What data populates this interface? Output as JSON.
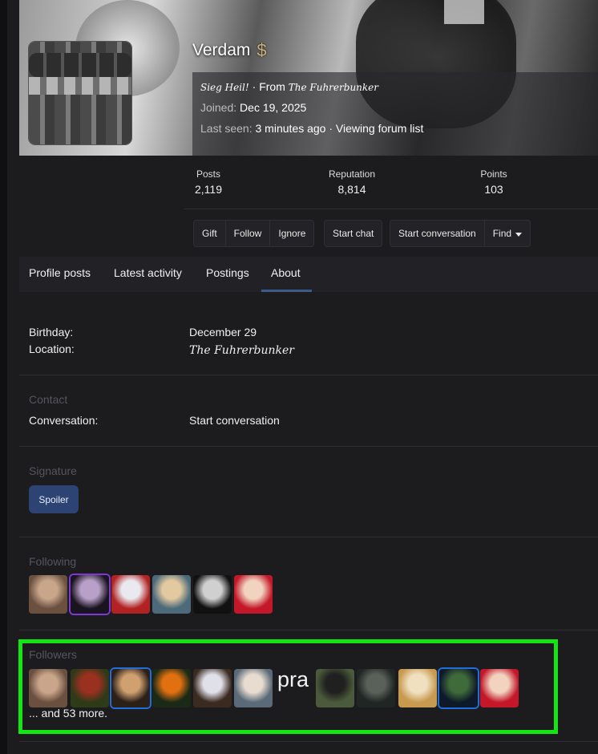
{
  "profile": {
    "username": "Verdam",
    "dollar_icon": "$",
    "tagline_title": "Sieg Heil!",
    "tagline_from": "From",
    "tagline_location": "The Fuhrerbunker",
    "separator": "·",
    "joined_label": "Joined:",
    "joined_value": "Dec 19, 2025",
    "last_seen_label": "Last seen:",
    "last_seen_value": "3 minutes ago",
    "last_seen_activity": "Viewing forum list"
  },
  "stats": [
    {
      "label": "Posts",
      "value": "2,119"
    },
    {
      "label": "Reputation",
      "value": "8,814"
    },
    {
      "label": "Points",
      "value": "103"
    }
  ],
  "actions": {
    "gift": "Gift",
    "follow": "Follow",
    "ignore": "Ignore",
    "start_chat": "Start chat",
    "start_conversation": "Start conversation",
    "find": "Find"
  },
  "tabs": [
    "Profile posts",
    "Latest activity",
    "Postings",
    "About"
  ],
  "about": {
    "birthday_label": "Birthday:",
    "birthday_value": "December 29",
    "location_label": "Location:",
    "location_value": "The Fuhrerbunker"
  },
  "contact": {
    "heading": "Contact",
    "conversation_label": "Conversation:",
    "conversation_value": "Start conversation"
  },
  "signature": {
    "heading": "Signature",
    "spoiler_label": "Spoiler"
  },
  "following": {
    "heading": "Following",
    "avatars": [
      {
        "name": "following-avatar-1",
        "colors": [
          "#6b5040",
          "#c9a68a"
        ]
      },
      {
        "name": "following-avatar-2",
        "colors": [
          "#1a1420",
          "#b9a0c8"
        ],
        "ring": "purple"
      },
      {
        "name": "following-avatar-3",
        "colors": [
          "#b32222",
          "#e9e9ef"
        ]
      },
      {
        "name": "following-avatar-4",
        "colors": [
          "#4c6a7a",
          "#e2c9a0"
        ]
      },
      {
        "name": "following-avatar-5",
        "colors": [
          "#111111",
          "#d0d0d0"
        ]
      },
      {
        "name": "following-avatar-6",
        "colors": [
          "#c4182a",
          "#f1d3c0"
        ]
      }
    ]
  },
  "followers": {
    "heading": "Followers",
    "inline_text": "pra",
    "more_text": "... and 53 more.",
    "avatars": [
      {
        "name": "follower-avatar-1",
        "colors": [
          "#6b5040",
          "#c9a68a"
        ]
      },
      {
        "name": "follower-avatar-2",
        "colors": [
          "#2f3a18",
          "#9a3020"
        ]
      },
      {
        "name": "follower-avatar-3",
        "colors": [
          "#2a2018",
          "#d0a070"
        ],
        "ring": "blue"
      },
      {
        "name": "follower-avatar-4",
        "colors": [
          "#1a2a16",
          "#e07010"
        ]
      },
      {
        "name": "follower-avatar-5",
        "colors": [
          "#3a2a20",
          "#e0e0e8"
        ]
      },
      {
        "name": "follower-avatar-6",
        "colors": [
          "#5a6a78",
          "#e8dcd0"
        ]
      },
      {
        "name": "follower-avatar-7",
        "colors": [
          "#4a5a3a",
          "#202020"
        ]
      },
      {
        "name": "follower-avatar-8",
        "colors": [
          "#202624",
          "#5a605a"
        ]
      },
      {
        "name": "follower-avatar-9",
        "colors": [
          "#c89a50",
          "#f0e0c0"
        ]
      },
      {
        "name": "follower-avatar-10",
        "colors": [
          "#0e1a2a",
          "#3f6a3a"
        ],
        "ring": "blue"
      },
      {
        "name": "follower-avatar-11",
        "colors": [
          "#c4182a",
          "#f1d3c0"
        ]
      }
    ]
  }
}
